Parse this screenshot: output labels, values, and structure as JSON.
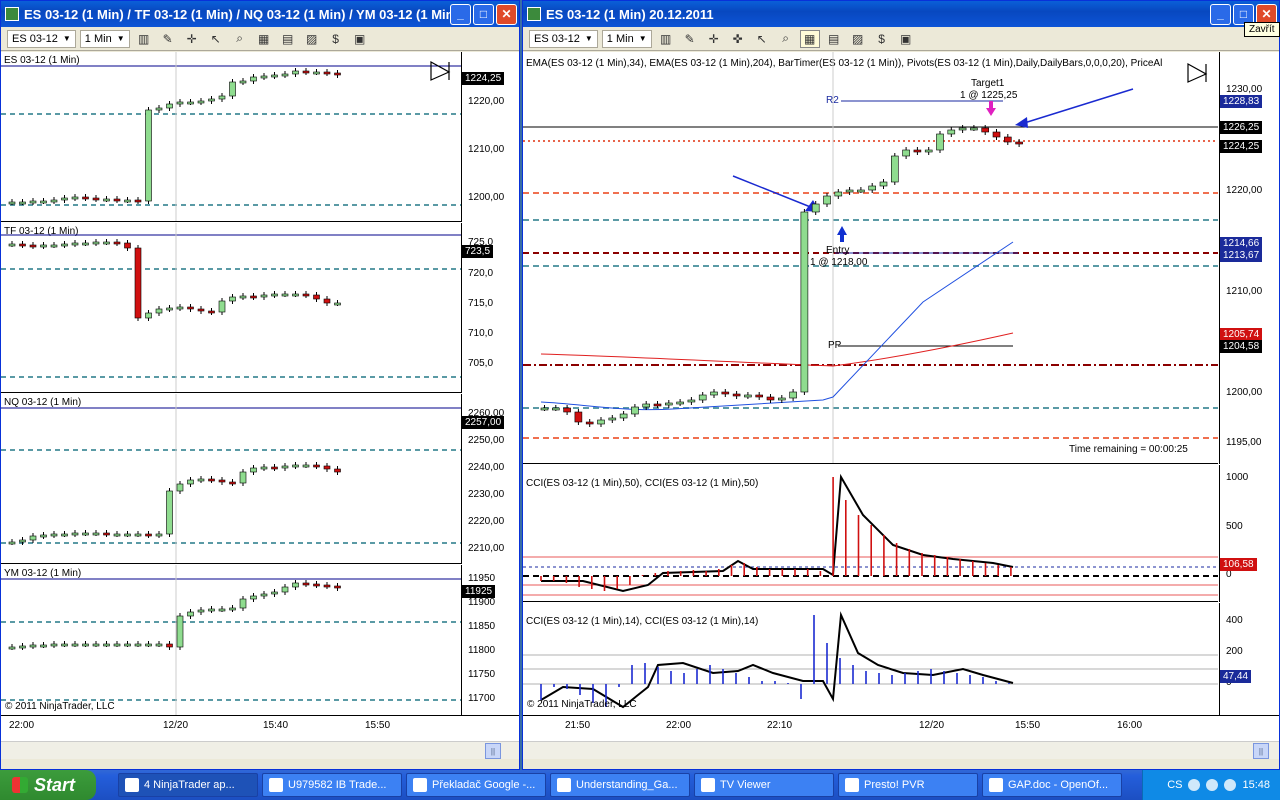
{
  "left_window": {
    "title": "ES 03-12 (1 Min) / TF 03-12 (1 Min) / NQ 03-12 (1 Min) / YM 03-12 (1 Min)",
    "instrument": "ES 03-12",
    "interval": "1 Min",
    "panels": [
      {
        "label": "ES 03-12 (1 Min)",
        "ticks": [
          "1220,00",
          "1210,00",
          "1200,00"
        ],
        "price": "1224,25"
      },
      {
        "label": "TF 03-12 (1 Min)",
        "ticks": [
          "725,0",
          "720,0",
          "715,0",
          "710,0",
          "705,0"
        ],
        "price": "723,5"
      },
      {
        "label": "NQ 03-12 (1 Min)",
        "ticks": [
          "2260,00",
          "2250,00",
          "2240,00",
          "2230,00",
          "2220,00",
          "2210,00"
        ],
        "price": "2257,00"
      },
      {
        "label": "YM 03-12 (1 Min)",
        "ticks": [
          "11950",
          "11900",
          "11850",
          "11800",
          "11750",
          "11700"
        ],
        "price": "11925"
      }
    ],
    "x_ticks": [
      "22:00",
      "12/20",
      "15:40",
      "15:50"
    ],
    "copyright": "© 2011 NinjaTrader, LLC"
  },
  "right_window": {
    "title": "ES 03-12 (1 Min)  20.12.2011",
    "instrument": "ES 03-12",
    "interval": "1 Min",
    "indicator_label": "EMA(ES 03-12 (1 Min),34), EMA(ES 03-12 (1 Min),204), BarTimer(ES 03-12 (1 Min)), Pivots(ES 03-12 (1 Min),Daily,DailyBars,0,0,0,20), PriceAl",
    "price_ticks": [
      "1230,00",
      "1220,00",
      "1210,00",
      "1200,00",
      "1195,00"
    ],
    "price_tags": [
      {
        "text": "1228,83",
        "bg": "#1a2a9a"
      },
      {
        "text": "1226,25",
        "bg": "#000000"
      },
      {
        "text": "1224,25",
        "bg": "#000000"
      },
      {
        "text": "1214,66",
        "bg": "#1a2a9a"
      },
      {
        "text": "1213,67",
        "bg": "#1a2a9a"
      },
      {
        "text": "1205,74",
        "bg": "#d01010"
      },
      {
        "text": "1204,58",
        "bg": "#000000"
      }
    ],
    "annotations": {
      "r2": "R2",
      "pp": "PP",
      "target": "Target1",
      "target_fill": "1 @ 1225,25",
      "entry": "Entry",
      "entry_fill": "1 @ 1218,00",
      "time_remaining": "Time remaining = 00:00:25"
    },
    "cci1": {
      "label": "CCI(ES 03-12 (1 Min),50), CCI(ES 03-12 (1 Min),50)",
      "ticks": [
        "1000",
        "500",
        "0"
      ],
      "value": "106,58"
    },
    "cci2": {
      "label": "CCI(ES 03-12 (1 Min),14), CCI(ES 03-12 (1 Min),14)",
      "ticks": [
        "400",
        "200",
        "0"
      ],
      "value": "47,44"
    },
    "x_ticks": [
      "21:50",
      "22:00",
      "22:10",
      "12/20",
      "15:50",
      "16:00"
    ],
    "copyright": "© 2011 NinjaTrader, LLC"
  },
  "tooltip": "Zavřít",
  "taskbar": {
    "start": "Start",
    "items": [
      "4 NinjaTrader ap...",
      "U979582 IB Trade...",
      "Překladač Google -...",
      "Understanding_Ga...",
      "TV Viewer",
      "Presto! PVR",
      "GAP.doc - OpenOf..."
    ],
    "lang": "CS",
    "clock": "15:48"
  }
}
